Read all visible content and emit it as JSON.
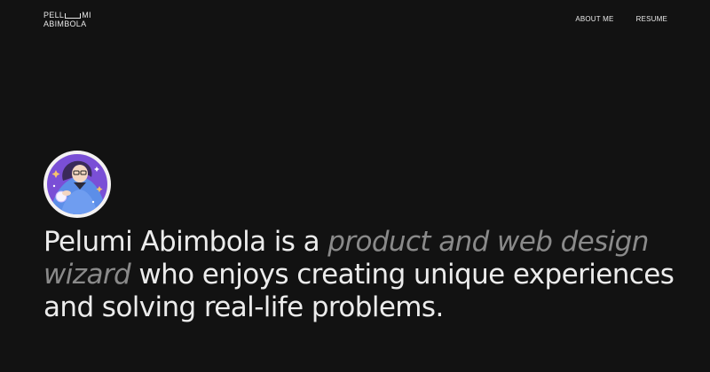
{
  "header": {
    "logo": {
      "line1_left": "PELL",
      "line1_right": "MI",
      "line2": "ABIMBOLA"
    },
    "nav": [
      {
        "label": "ABOUT ME"
      },
      {
        "label": "RESUME"
      }
    ]
  },
  "hero": {
    "avatar_icon": "illustrated-wizard-avatar",
    "text_part1": "Pelumi Abimbola is a ",
    "text_accent": "product and web design wizard",
    "text_part2": " who enjoys creating unique experiences and solving real-life problems."
  },
  "colors": {
    "background": "#121212",
    "text": "#ececec",
    "accent_text": "#8a8a8a",
    "avatar_purple": "#7a4fd6"
  }
}
